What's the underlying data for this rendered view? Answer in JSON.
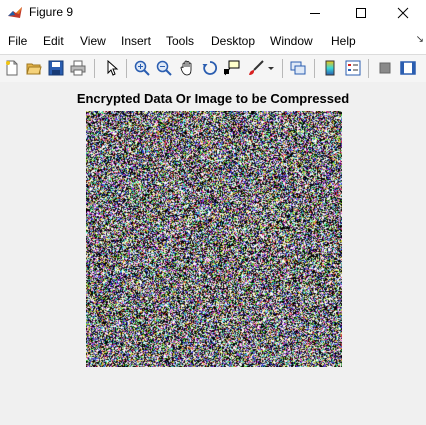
{
  "window": {
    "title": "Figure 9",
    "controls": [
      "minimize",
      "maximize",
      "close"
    ]
  },
  "menu": {
    "items": [
      "File",
      "Edit",
      "View",
      "Insert",
      "Tools",
      "Desktop",
      "Window",
      "Help"
    ],
    "overflow_icon": "dock-arrow-icon"
  },
  "toolbar": {
    "buttons": [
      "new-figure-icon",
      "open-file-icon",
      "save-icon",
      "print-icon",
      "edit-plot-arrow-icon",
      "zoom-in-icon",
      "zoom-out-icon",
      "pan-hand-icon",
      "rotate-3d-icon",
      "data-cursor-icon",
      "brush-icon",
      "link-plot-icon",
      "colorbar-icon",
      "legend-icon",
      "hide-plot-tools-icon",
      "show-plot-tools-icon"
    ]
  },
  "figure": {
    "axes_title": "Encrypted Data Or Image to be Compressed",
    "image": {
      "content": "random noise pixels (encrypted data)",
      "palette": [
        "#000000",
        "#ffffff",
        "#7f7f7f",
        "#3a3ad8",
        "#d8d83a",
        "#3ad8d8",
        "#d83ad8",
        "#d83a3a",
        "#3ad83a"
      ]
    }
  },
  "colors": {
    "titlebar_bg": "#ffffff",
    "menubar_bg": "#ffffff",
    "toolbar_bg": "#f5f5f5",
    "figure_bg": "#f0f0f0"
  }
}
